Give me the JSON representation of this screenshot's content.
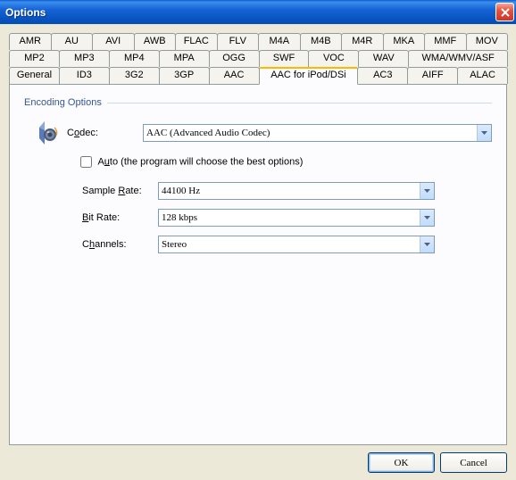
{
  "window": {
    "title": "Options"
  },
  "close_x": "X",
  "tabs": {
    "row1": [
      "AMR",
      "AU",
      "AVI",
      "AWB",
      "FLAC",
      "FLV",
      "M4A",
      "M4B",
      "M4R",
      "MKA",
      "MMF",
      "MOV"
    ],
    "row2": [
      "MP2",
      "MP3",
      "MP4",
      "MPA",
      "OGG",
      "SWF",
      "VOC",
      "WAV",
      "WMA/WMV/ASF"
    ],
    "row3": [
      "General",
      "ID3",
      "3G2",
      "3GP",
      "AAC",
      "AAC for iPod/DSi",
      "AC3",
      "AIFF",
      "ALAC"
    ],
    "active": "AAC for iPod/DSi"
  },
  "group": "Encoding Options",
  "codec": {
    "label_pre": "C",
    "label_u": "o",
    "label_post": "dec:",
    "value": "AAC (Advanced Audio Codec)"
  },
  "auto": {
    "label_pre": "A",
    "label_u": "u",
    "label_post": "to (the program will choose the best options)",
    "checked": false
  },
  "samplerate": {
    "label_pre": "Sample ",
    "label_u": "R",
    "label_post": "ate:",
    "value": "44100 Hz"
  },
  "bitrate": {
    "label_u": "B",
    "label_post": "it Rate:",
    "value": "128 kbps"
  },
  "channels": {
    "label_pre": "C",
    "label_u": "h",
    "label_post": "annels:",
    "value": "Stereo"
  },
  "buttons": {
    "ok": "OK",
    "cancel": "Cancel"
  }
}
